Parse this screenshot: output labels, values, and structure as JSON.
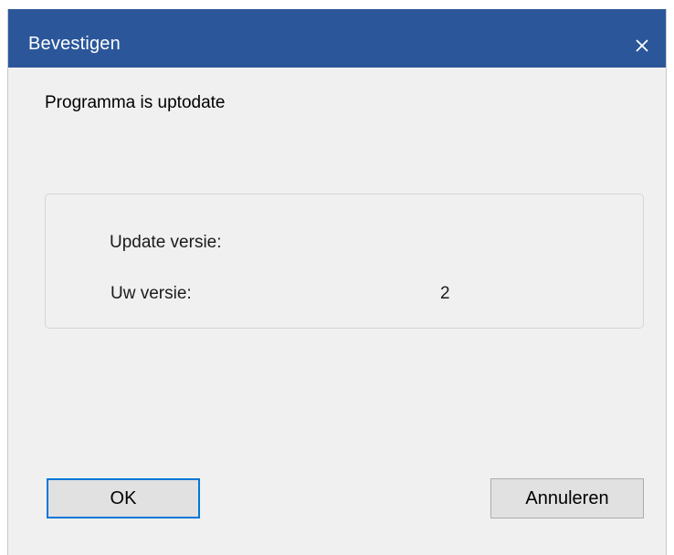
{
  "dialog": {
    "title": "Bevestigen",
    "close_icon": "close-icon",
    "message": "Programma is uptodate",
    "info": {
      "update_label": "Update versie:",
      "update_value": "",
      "current_label": "Uw versie:",
      "current_value": "2"
    },
    "buttons": {
      "ok_label": "OK",
      "cancel_label": "Annuleren"
    }
  },
  "colors": {
    "titlebar": "#2b579a",
    "window_background": "#f0f0f0",
    "button_background": "#e1e1e1",
    "default_button_border": "#0078d7"
  }
}
